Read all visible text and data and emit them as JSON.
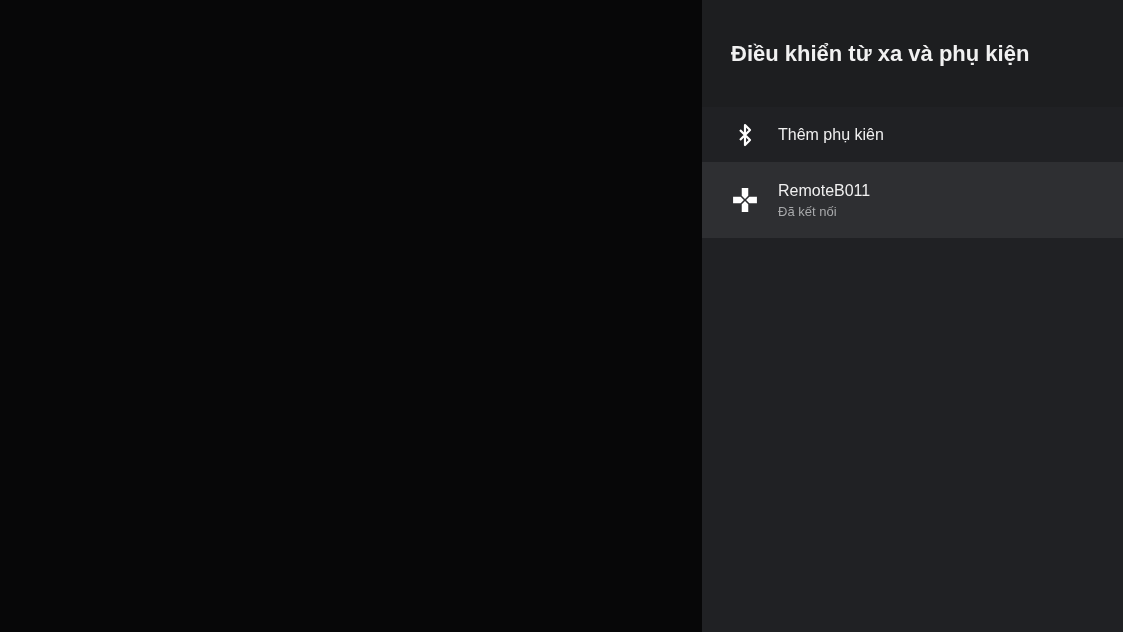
{
  "panel": {
    "title": "Điều khiển từ xa và phụ kiện"
  },
  "items": [
    {
      "kind": "bluetooth",
      "label": "Thêm phụ kiên",
      "selected": false
    },
    {
      "kind": "gamepad",
      "label": "RemoteB011",
      "status": "Đã kết nối",
      "selected": true
    }
  ]
}
